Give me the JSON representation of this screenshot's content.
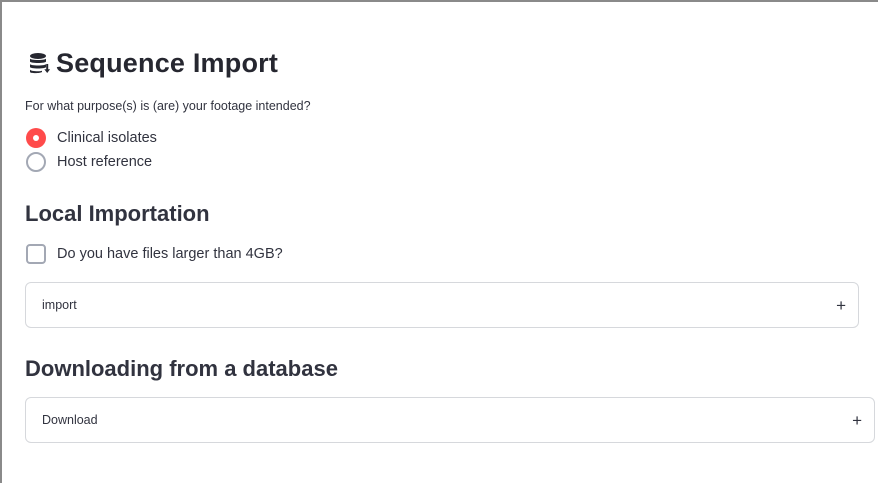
{
  "header": {
    "title": "Sequence Import",
    "icon": "database-download-icon"
  },
  "purpose": {
    "question": "For what purpose(s) is (are) your footage intended?",
    "options": [
      {
        "label": "Clinical isolates",
        "selected": true
      },
      {
        "label": "Host reference",
        "selected": false
      }
    ]
  },
  "local": {
    "heading": "Local Importation",
    "checkbox_label": "Do you have files larger than 4GB?",
    "checkbox_checked": false,
    "expander_label": "import",
    "expander_icon": "+"
  },
  "database": {
    "heading": "Downloading from a database",
    "expander_label": "Download",
    "expander_icon": "+"
  },
  "colors": {
    "accent": "#ff4b4b",
    "text": "#31333f",
    "border": "#d6d8dc"
  }
}
